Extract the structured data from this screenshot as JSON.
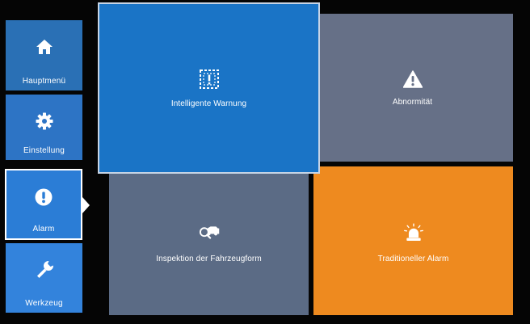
{
  "sidebar": {
    "items": [
      {
        "label": "Hauptmenü",
        "icon": "home-icon"
      },
      {
        "label": "Einstellung",
        "icon": "gear-icon"
      },
      {
        "label": "Alarm",
        "icon": "alert-circle-icon",
        "selected": true
      },
      {
        "label": "Werkzeug",
        "icon": "wrench-icon"
      }
    ]
  },
  "tiles": {
    "smart_warning": {
      "label": "Intelligente Warnung",
      "icon": "dashed-warning-box-icon",
      "focused": true
    },
    "abnormity": {
      "label": "Abnormität",
      "icon": "warning-triangle-icon"
    },
    "inspection": {
      "label": "Inspektion der Fahrzeugform",
      "icon": "vehicle-search-icon"
    },
    "traditional": {
      "label": "Traditioneller Alarm",
      "icon": "siren-icon"
    }
  },
  "colors": {
    "background": "#050505",
    "nav_blue": "#2d74c5",
    "smart_warning": "#1a74c6",
    "abnormity": "#667087",
    "inspection": "#5b6b85",
    "traditional": "#ee8a1f"
  }
}
